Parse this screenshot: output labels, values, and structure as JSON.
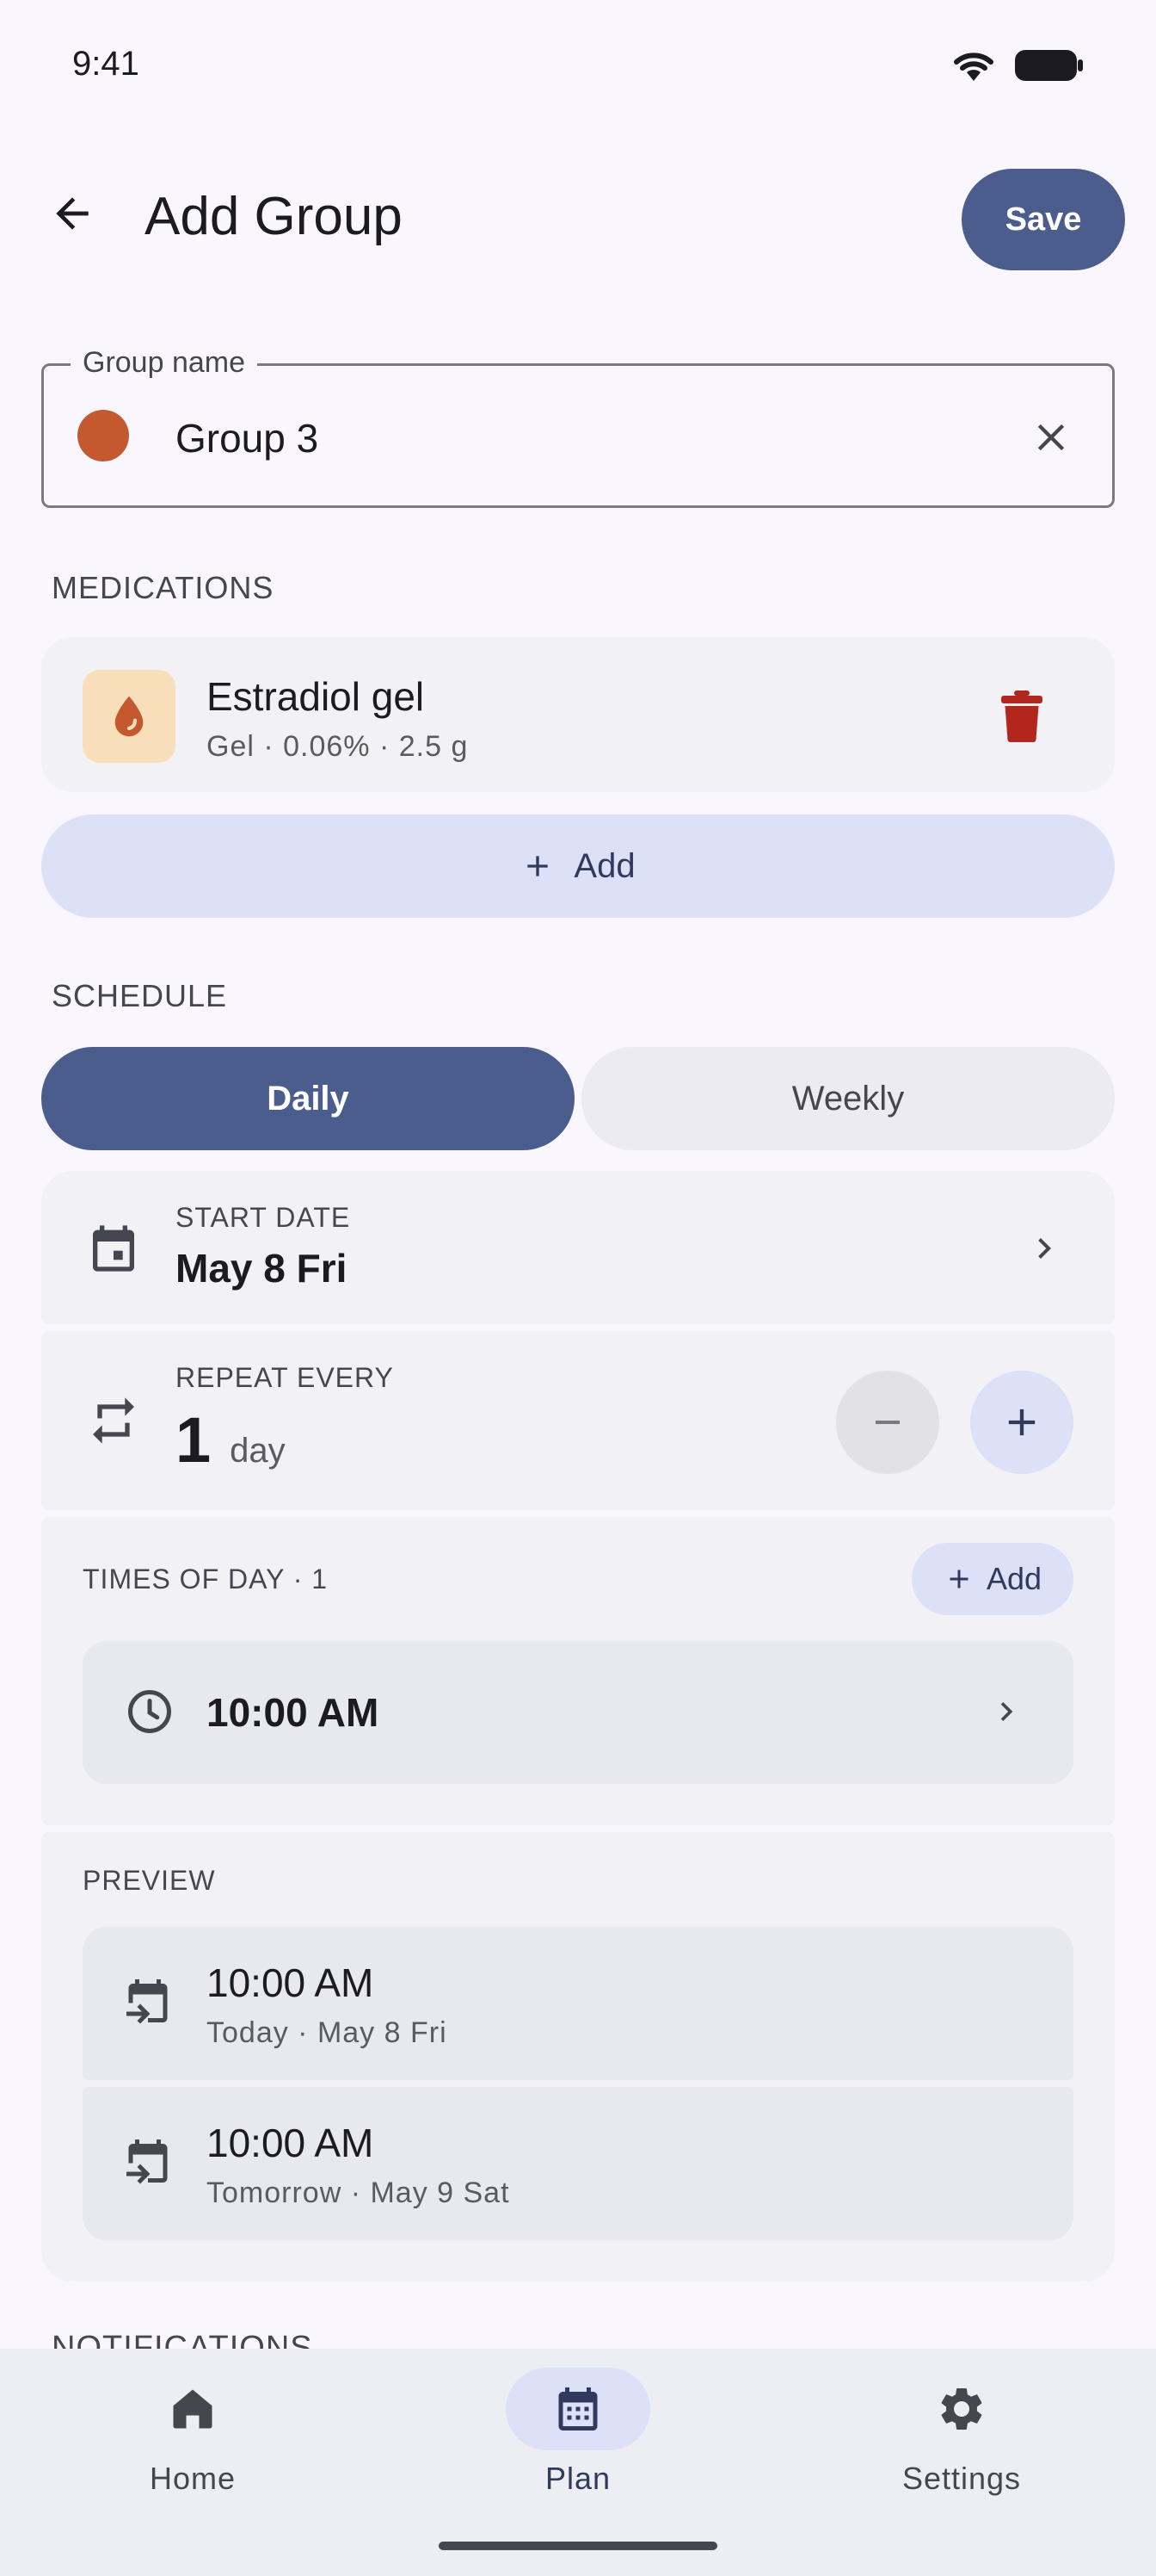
{
  "status_bar": {
    "time": "9:41"
  },
  "header": {
    "title": "Add Group",
    "save_label": "Save"
  },
  "group_name": {
    "label": "Group name",
    "value": "Group 3",
    "color": "#c4582e"
  },
  "medications": {
    "section_title": "MEDICATIONS",
    "items": [
      {
        "name": "Estradiol gel",
        "detail": "Gel · 0.06% · 2.5 g",
        "icon": "drop-icon"
      }
    ],
    "add_label": "Add"
  },
  "schedule": {
    "section_title": "SCHEDULE",
    "tabs": [
      {
        "label": "Daily",
        "selected": true
      },
      {
        "label": "Weekly",
        "selected": false
      }
    ],
    "start_date": {
      "label": "START DATE",
      "value": "May 8 Fri"
    },
    "repeat": {
      "label": "REPEAT EVERY",
      "value": "1",
      "unit": "day"
    },
    "times_of_day": {
      "label": "TIMES OF DAY · 1",
      "add_label": "Add",
      "times": [
        "10:00 AM"
      ]
    },
    "preview": {
      "label": "PREVIEW",
      "items": [
        {
          "time": "10:00 AM",
          "subtitle": "Today · May 8 Fri"
        },
        {
          "time": "10:00 AM",
          "subtitle": "Tomorrow · May 9 Sat"
        }
      ]
    }
  },
  "notifications_peek": "NOTIFICATIONS",
  "bottom_nav": {
    "items": [
      {
        "label": "Home",
        "icon": "home-icon",
        "selected": false
      },
      {
        "label": "Plan",
        "icon": "calendar-icon",
        "selected": true
      },
      {
        "label": "Settings",
        "icon": "gear-icon",
        "selected": false
      }
    ]
  },
  "colors": {
    "primary": "#4b5d8c",
    "primary_container": "#dde1f8",
    "danger": "#b3261e",
    "group_color": "#c4582e"
  }
}
